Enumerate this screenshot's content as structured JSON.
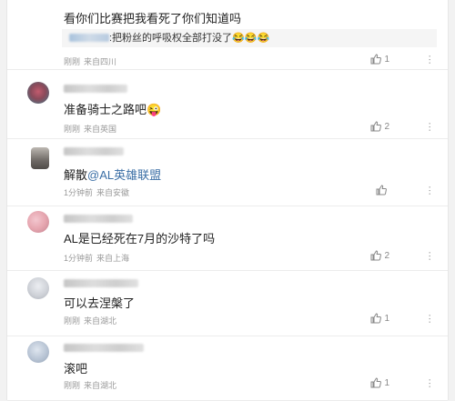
{
  "comments": [
    {
      "text": "看你们比赛把我看死了你们知道吗",
      "quote": {
        "text": ":把粉丝的呼吸权全部打没了",
        "emoji": "😂😂😂"
      },
      "time": "刚刚",
      "location": "来自四川",
      "likes": "1"
    },
    {
      "text": "准备骑士之路吧",
      "emoji": "😜",
      "time": "刚刚",
      "location": "来自英国",
      "likes": "2",
      "avatar_color": "#8a4a5a"
    },
    {
      "text_prefix": "解散",
      "mention": "@AL英雄联盟",
      "time": "1分钟前",
      "location": "来自安徽",
      "likes": "",
      "avatar_color": "#7a7672"
    },
    {
      "text": "AL是已经死在7月的沙特了吗",
      "time": "1分钟前",
      "location": "来自上海",
      "likes": "2",
      "avatar_color": "#e6a6b0"
    },
    {
      "text": "可以去涅槃了",
      "time": "刚刚",
      "location": "来自湖北",
      "likes": "1",
      "avatar_color": "#cfd2d8"
    },
    {
      "text": "滚吧",
      "time": "刚刚",
      "location": "来自湖北",
      "likes": "1",
      "avatar_color": "#b8c4d4"
    }
  ],
  "icons": {
    "like": "thumbs-up-icon",
    "more": "more-dots-icon"
  },
  "colors": {
    "link": "#3a6ea5",
    "meta": "#999999",
    "quote_bg": "#f5f5f5"
  }
}
